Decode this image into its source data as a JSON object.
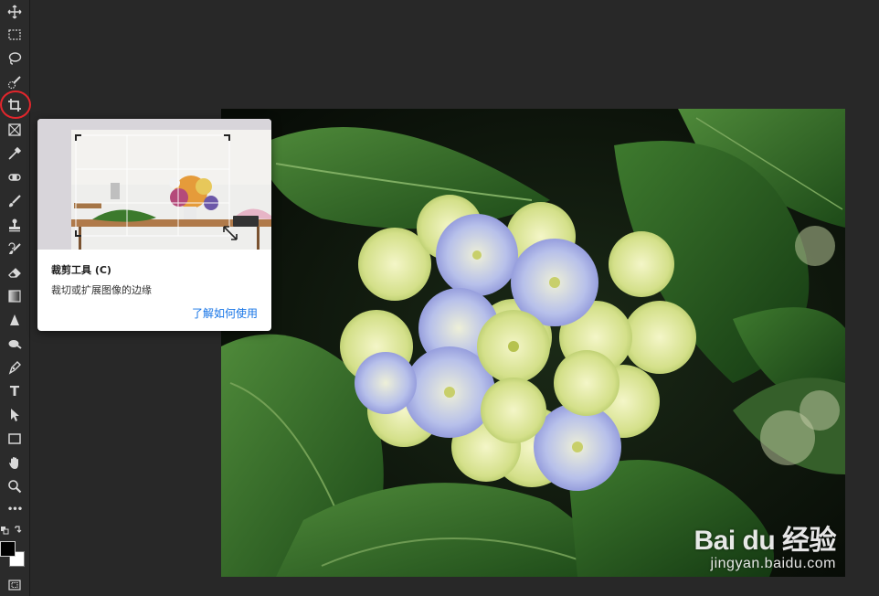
{
  "toolbar": {
    "selected_tool": "crop-tool",
    "highlight_color": "#e2262c",
    "tools": [
      {
        "name": "move-tool",
        "icon": "move-icon"
      },
      {
        "name": "marquee-tool",
        "icon": "rect-marquee-icon"
      },
      {
        "name": "lasso-tool",
        "icon": "lasso-icon"
      },
      {
        "name": "quick-selection-tool",
        "icon": "quick-select-icon"
      },
      {
        "name": "crop-tool",
        "icon": "crop-icon"
      },
      {
        "name": "frame-tool",
        "icon": "frame-icon"
      },
      {
        "name": "eyedropper-tool",
        "icon": "eyedropper-icon"
      },
      {
        "name": "spot-healing-tool",
        "icon": "bandage-icon"
      },
      {
        "name": "brush-tool",
        "icon": "brush-icon"
      },
      {
        "name": "clone-stamp-tool",
        "icon": "stamp-icon"
      },
      {
        "name": "history-brush-tool",
        "icon": "history-brush-icon"
      },
      {
        "name": "eraser-tool",
        "icon": "eraser-icon"
      },
      {
        "name": "gradient-tool",
        "icon": "gradient-icon"
      },
      {
        "name": "sharpen-tool",
        "icon": "triangle-icon"
      },
      {
        "name": "dodge-tool",
        "icon": "dodge-icon"
      },
      {
        "name": "pen-tool",
        "icon": "pen-icon"
      },
      {
        "name": "type-tool",
        "icon": "type-icon"
      },
      {
        "name": "path-selection-tool",
        "icon": "arrow-icon"
      },
      {
        "name": "rectangle-tool",
        "icon": "rectangle-icon"
      },
      {
        "name": "hand-tool",
        "icon": "hand-icon"
      },
      {
        "name": "zoom-tool",
        "icon": "magnifier-icon"
      },
      {
        "name": "more-tools",
        "icon": "ellipsis-icon"
      }
    ],
    "type_glyph": "T",
    "more_glyph": "•••",
    "foreground_color": "#000000",
    "background_color": "#ffffff"
  },
  "tooltip": {
    "title": "裁剪工具 (C)",
    "description": "裁切或扩展图像的边缘",
    "link": "了解如何使用",
    "link_color": "#1473e6"
  },
  "canvas": {
    "watermark_brand": "Bai du 经验",
    "watermark_url": "jingyan.baidu.com"
  }
}
